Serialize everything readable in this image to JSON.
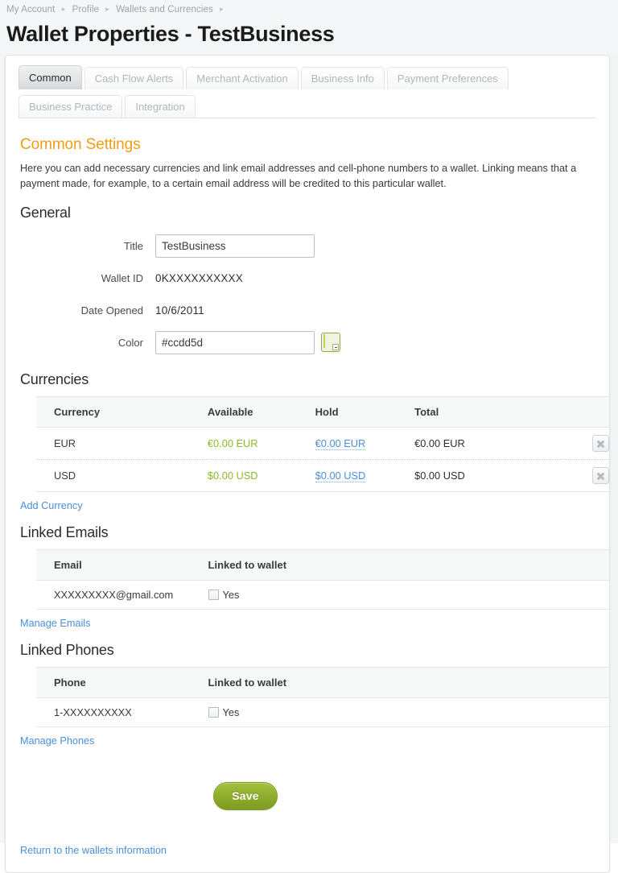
{
  "breadcrumb": {
    "items": [
      "My Account",
      "Profile",
      "Wallets and Currencies"
    ],
    "separator": "▸"
  },
  "header": {
    "title": "Wallet Properties - TestBusiness"
  },
  "tabs": {
    "row1": [
      {
        "label": "Common",
        "active": true
      },
      {
        "label": "Cash Flow Alerts",
        "active": false
      },
      {
        "label": "Merchant Activation",
        "active": false
      },
      {
        "label": "Business Info",
        "active": false
      },
      {
        "label": "Payment Preferences",
        "active": false
      }
    ],
    "row2": [
      {
        "label": "Business Practice",
        "active": false
      },
      {
        "label": "Integration",
        "active": false
      }
    ]
  },
  "content": {
    "section_title": "Common Settings",
    "intro": "Here you can add necessary currencies and link email addresses and cell-phone numbers to a wallet. Linking means that a payment made, for example, to a certain email address will be credited to this particular wallet."
  },
  "general": {
    "heading": "General",
    "fields": [
      {
        "label": "Title",
        "value": "TestBusiness",
        "type": "input"
      },
      {
        "label": "Wallet ID",
        "value": "0KXXXXXXXXXX",
        "type": "static"
      },
      {
        "label": "Date Opened",
        "value": "10/6/2011",
        "type": "static"
      },
      {
        "label": "Color",
        "value": "#ccdd5d",
        "type": "input-color"
      }
    ],
    "color_value": "#ccdd5d"
  },
  "currencies": {
    "heading": "Currencies",
    "columns": [
      "Currency",
      "Available",
      "Hold",
      "Total"
    ],
    "rows": [
      {
        "currency": "EUR",
        "available": "€0.00 EUR",
        "hold": "€0.00 EUR",
        "total": "€0.00 EUR"
      },
      {
        "currency": "USD",
        "available": "$0.00 USD",
        "hold": "$0.00 USD",
        "total": "$0.00 USD"
      }
    ],
    "add_link": "Add Currency",
    "colors": {
      "available": "#8cb92b",
      "hold": "#4a90d9",
      "total": "#2e2e2e"
    }
  },
  "emails": {
    "heading": "Linked Emails",
    "columns": [
      "Email",
      "Linked to wallet"
    ],
    "rows": [
      {
        "email": "XXXXXXXXX@gmail.com",
        "linked_label": "Yes",
        "linked": false
      }
    ],
    "manage_link": "Manage Emails"
  },
  "phones": {
    "heading": "Linked Phones",
    "columns": [
      "Phone",
      "Linked to wallet"
    ],
    "rows": [
      {
        "phone": "1-XXXXXXXXXX",
        "linked_label": "Yes",
        "linked": false
      }
    ],
    "manage_link": "Manage Phones"
  },
  "actions": {
    "save_label": "Save",
    "return_link": "Return to the wallets information"
  },
  "theme": {
    "accent": "#f39c12",
    "link": "#4a90d9",
    "save_button": "#8fae2c",
    "swatch": "#ccdd5d"
  }
}
